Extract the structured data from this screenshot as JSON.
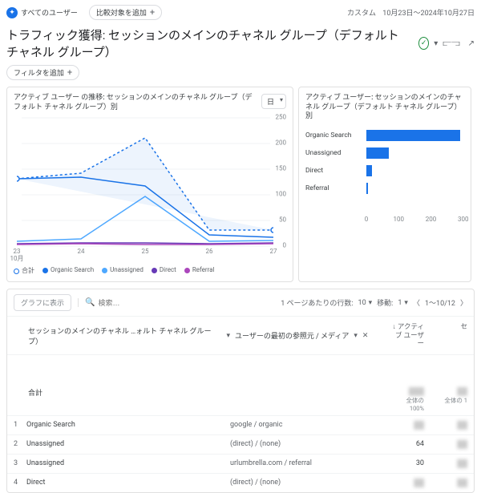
{
  "chips": {
    "all_users_badge": "すべてのユーザー",
    "add_compare": "比較対象を追加"
  },
  "date": {
    "label": "カスタム",
    "range": "10月23日～2024年10月27日"
  },
  "title": "トラフィック獲得: セッションのメインのチャネル グループ（デフォルト チャネル グループ）",
  "filter_add": "フィルタを追加",
  "line_card": {
    "title": "アクティブ ユーザー の推移: セッションのメインのチャネル グループ（デフォルト チャネル グループ）別",
    "granularity": "日",
    "month_label": "10月"
  },
  "bar_card": {
    "title": "アクティブ ユーザー: セッションのメインのチャネル グループ（デフォルト チャネル グループ）別"
  },
  "chart_data": {
    "line": {
      "type": "line",
      "x": [
        "23",
        "24",
        "25",
        "26",
        "27"
      ],
      "ylim": [
        0,
        250
      ],
      "yticks": [
        0,
        50,
        100,
        150,
        200,
        250
      ],
      "series": [
        {
          "name": "合計",
          "color": "ring",
          "values": [
            130,
            140,
            210,
            30,
            30
          ],
          "style": "dash"
        },
        {
          "name": "Organic Search",
          "color": "#1a73e8",
          "values": [
            120,
            125,
            115,
            20,
            15
          ]
        },
        {
          "name": "Unassigned",
          "color": "#4ea8ff",
          "values": [
            8,
            12,
            95,
            8,
            10
          ]
        },
        {
          "name": "Direct",
          "color": "#673ab7",
          "values": [
            3,
            5,
            4,
            3,
            5
          ]
        },
        {
          "name": "Referral",
          "color": "#ab47bc",
          "values": [
            2,
            3,
            2,
            2,
            3
          ]
        }
      ]
    },
    "bar": {
      "type": "bar",
      "xlim": [
        0,
        300
      ],
      "categories": [
        "Organic Search",
        "Unassigned",
        "Direct",
        "Referral"
      ],
      "values": [
        290,
        70,
        18,
        6
      ]
    }
  },
  "legend": [
    "合計",
    "Organic Search",
    "Unassigned",
    "Direct",
    "Referral"
  ],
  "table": {
    "show_in_chart": "グラフに表示",
    "search_placeholder": "検索…",
    "rows_per_page_label": "1 ページあたりの行数:",
    "rows_per_page": "10",
    "goto_label": "移動:",
    "goto_page": "1",
    "range": "1～10/12",
    "dim1": "セッションのメインのチャネル …ォルト チャネル グループ）",
    "dim2": "ユーザーの最初の参照元 / メディア",
    "metric1": "アクティブ ユーザー",
    "metric2": "セ",
    "total_label": "合計",
    "total_sub1": "全体の 100%",
    "total_sub2": "全体の 1",
    "rows": [
      {
        "i": "1",
        "channel": "Organic Search",
        "source": "google / organic",
        "v1": "",
        "v2": ""
      },
      {
        "i": "2",
        "channel": "Unassigned",
        "source": "(direct) / (none)",
        "v1": "64",
        "v2": ""
      },
      {
        "i": "3",
        "channel": "Unassigned",
        "source": "urlumbrella.com / referral",
        "v1": "30",
        "v2": ""
      },
      {
        "i": "4",
        "channel": "Direct",
        "source": "(direct) / (none)",
        "v1": "",
        "v2": ""
      }
    ]
  }
}
